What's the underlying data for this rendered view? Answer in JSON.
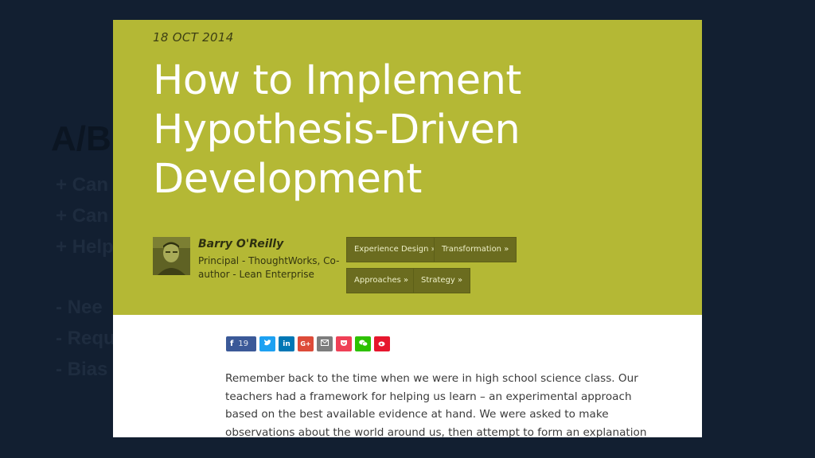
{
  "slide": {
    "title": "A/B",
    "bullets": [
      "+ Can",
      "+ Can",
      "+ Help",
      "- Nee",
      "- Requ",
      "- Bias"
    ]
  },
  "article": {
    "date": "18 OCT 2014",
    "title_lines": [
      "How to Implement",
      "Hypothesis-Driven",
      "Development"
    ],
    "author_name": "Barry O'Reilly",
    "author_role": "Principal - ThoughtWorks, Co-author - Lean Enterprise",
    "tags": [
      "Experience Design »",
      "Transformation »",
      "Approaches »",
      "Strategy »"
    ],
    "share": {
      "facebook_count": "19",
      "buttons": [
        "facebook-icon",
        "twitter-icon",
        "linkedin-icon",
        "google-plus-icon",
        "email-icon",
        "pocket-icon",
        "wechat-icon",
        "weibo-icon"
      ]
    },
    "body_text": "Remember back to the time when we were in high school science class. Our teachers had a framework for helping us learn – an experimental approach based on the best available evidence at hand. We were asked to make observations about the world around us, then attempt to form an explanation or hypothesis to explain what we had",
    "colors": {
      "hero_bg": "#b4b835",
      "tag_bg": "#6b6c1f",
      "page_bg": "#121f31"
    }
  }
}
